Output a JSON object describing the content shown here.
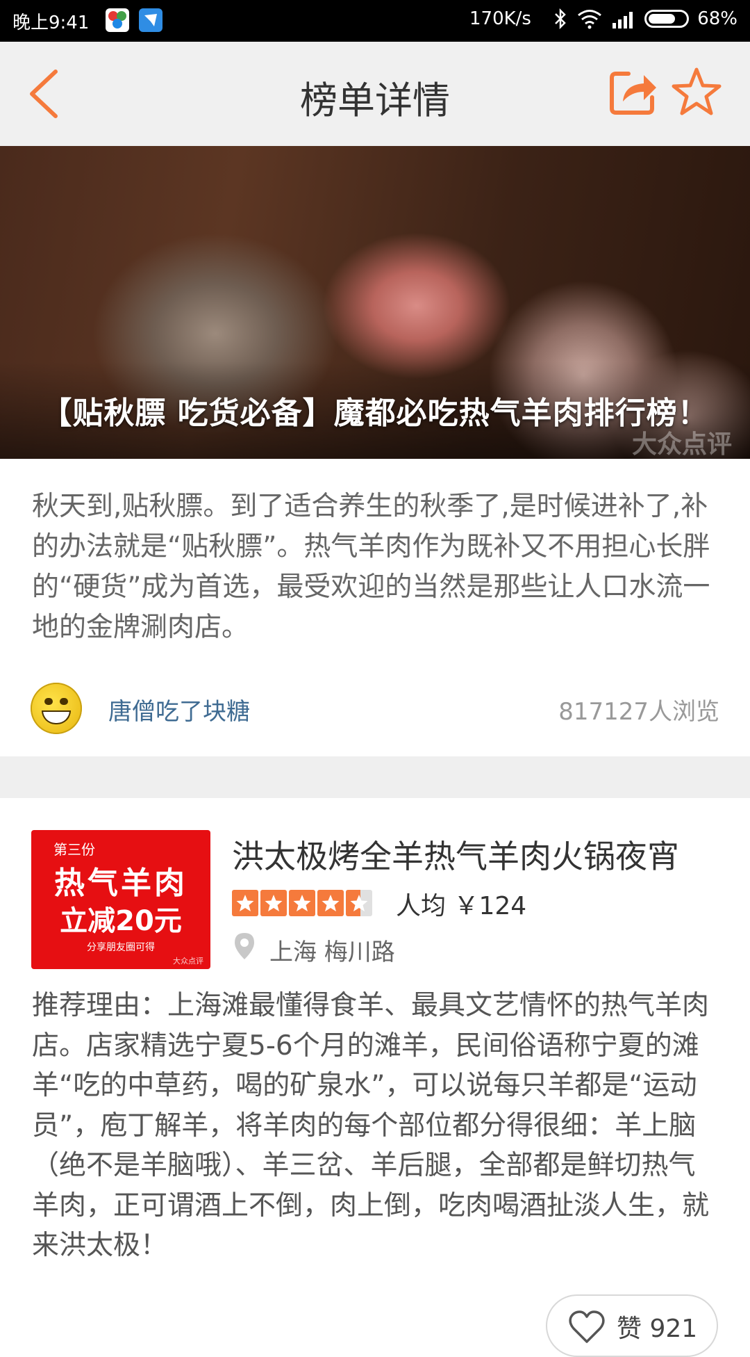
{
  "status_bar": {
    "time": "晚上9:41",
    "net_speed": "170K/s",
    "battery": "68%"
  },
  "header": {
    "title": "榜单详情"
  },
  "hero": {
    "title": "【贴秋膘 吃货必备】魔都必吃热气羊肉排行榜！",
    "watermark": "大众点评"
  },
  "intro": {
    "text": "秋天到,贴秋膘。到了适合养生的秋季了,是时候进补了,补的办法就是“贴秋膘”。热气羊肉作为既补又不用担心长胖的“硬货”成为首选，最受欢迎的当然是那些让人口水流一地的金牌涮肉店。",
    "author": "唐僧吃了块糖",
    "views": "817127人浏览"
  },
  "restaurant": {
    "name": "洪太极烤全羊热气羊肉火锅夜宵",
    "rating": 4.5,
    "price": "人均 ￥124",
    "location": "上海 梅川路",
    "promo": {
      "line1": "第三份",
      "line2": "热气羊肉",
      "line3": "立减20元",
      "line4": "分享朋友圈可得",
      "line5": "大众点评"
    },
    "reason": "推荐理由：上海滩最懂得食羊、最具文艺情怀的热气羊肉店。店家精选宁夏5-6个月的滩羊，民间俗语称宁夏的滩羊“吃的中草药，喝的矿泉水”，可以说每只羊都是“运动员”，庖丁解羊，将羊肉的每个部位都分得很细：羊上脑（绝不是羊脑哦）、羊三岔、羊后腿，全部都是鲜切热气羊肉，正可谓酒上不倒，肉上倒，吃肉喝酒扯淡人生，就来洪太极！",
    "likes_label": "赞 921"
  },
  "colors": {
    "accent": "#f57a3c",
    "promo_red": "#e60f12",
    "author_blue": "#3f6b92"
  },
  "icons": [
    "back-chevron-icon",
    "share-icon",
    "star-icon",
    "location-pin-icon",
    "heart-icon",
    "bluetooth-icon",
    "wifi-icon",
    "signal-icon",
    "battery-icon"
  ]
}
